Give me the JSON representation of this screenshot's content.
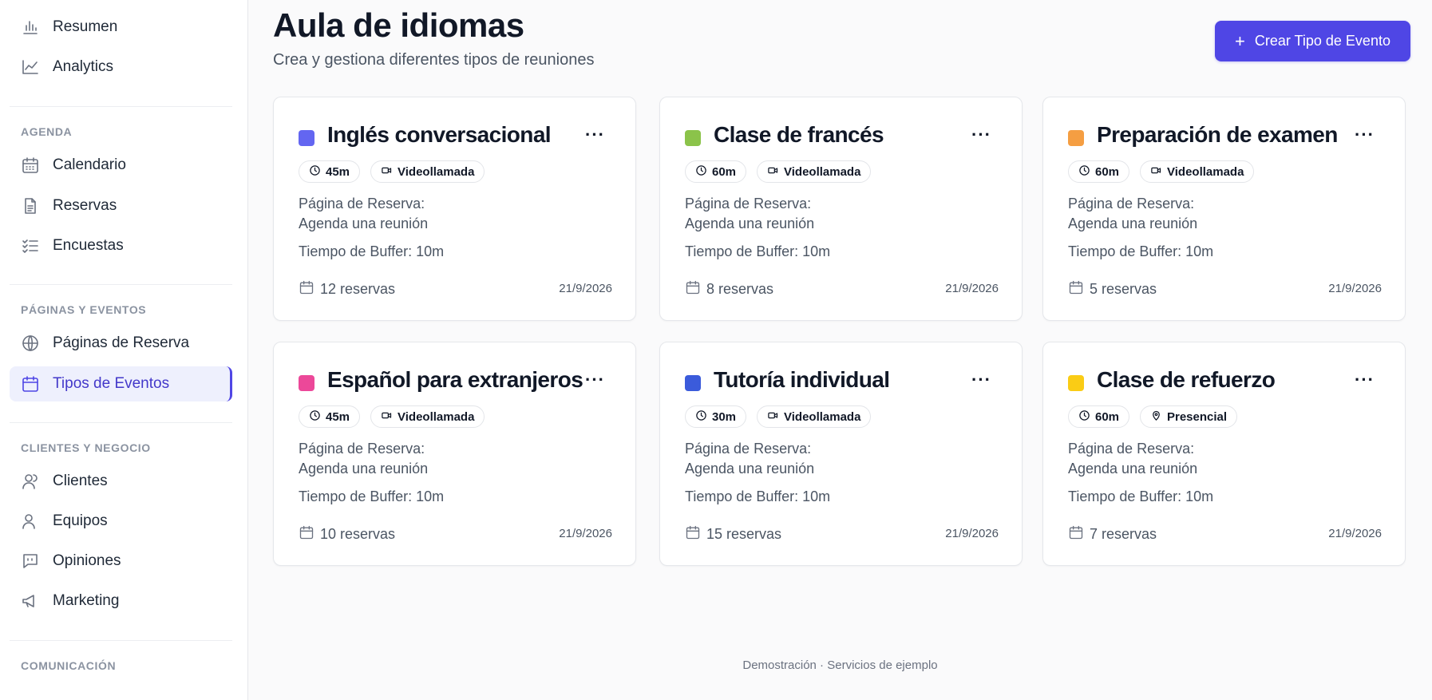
{
  "sidebar": {
    "top_items": [
      {
        "label": "Resumen",
        "icon": "bar-chart-icon"
      },
      {
        "label": "Analytics",
        "icon": "line-chart-icon"
      }
    ],
    "sections": [
      {
        "label": "AGENDA",
        "items": [
          {
            "label": "Calendario",
            "icon": "calendar-icon"
          },
          {
            "label": "Reservas",
            "icon": "document-icon"
          },
          {
            "label": "Encuestas",
            "icon": "checklist-icon"
          }
        ]
      },
      {
        "label": "PÁGINAS Y EVENTOS",
        "items": [
          {
            "label": "Páginas de Reserva",
            "icon": "globe-icon"
          },
          {
            "label": "Tipos de Eventos",
            "icon": "calendar-icon",
            "active": true
          }
        ]
      },
      {
        "label": "CLIENTES Y NEGOCIO",
        "items": [
          {
            "label": "Clientes",
            "icon": "user-icon"
          },
          {
            "label": "Equipos",
            "icon": "users-icon"
          },
          {
            "label": "Opiniones",
            "icon": "message-icon"
          },
          {
            "label": "Marketing",
            "icon": "megaphone-icon"
          }
        ]
      },
      {
        "label": "COMUNICACIÓN",
        "items": []
      }
    ]
  },
  "header": {
    "title": "Aula de idiomas",
    "subtitle": "Crea y gestiona diferentes tipos de reuniones",
    "create_button": "Crear Tipo de Evento"
  },
  "labels": {
    "booking_page_label": "Página de Reserva:",
    "booking_page_value": "Agenda una reunión",
    "buffer": "Tiempo de Buffer: 10m"
  },
  "events": [
    {
      "title": "Inglés conversacional",
      "color": "#6366f1",
      "duration": "45m",
      "mode": "Videollamada",
      "mode_icon": "video-icon",
      "reservations": "12 reservas",
      "date": "21/9/2026"
    },
    {
      "title": "Clase de francés",
      "color": "#8bc34a",
      "duration": "60m",
      "mode": "Videollamada",
      "mode_icon": "video-icon",
      "reservations": "8 reservas",
      "date": "21/9/2026"
    },
    {
      "title": "Preparación de examen",
      "color": "#f59e42",
      "duration": "60m",
      "mode": "Videollamada",
      "mode_icon": "video-icon",
      "reservations": "5 reservas",
      "date": "21/9/2026"
    },
    {
      "title": "Español para extranjeros",
      "color": "#ec4899",
      "duration": "45m",
      "mode": "Videollamada",
      "mode_icon": "video-icon",
      "reservations": "10 reservas",
      "date": "21/9/2026"
    },
    {
      "title": "Tutoría individual",
      "color": "#3b5bdb",
      "duration": "30m",
      "mode": "Videollamada",
      "mode_icon": "video-icon",
      "reservations": "15 reservas",
      "date": "21/9/2026"
    },
    {
      "title": "Clase de refuerzo",
      "color": "#facc15",
      "duration": "60m",
      "mode": "Presencial",
      "mode_icon": "map-pin-icon",
      "reservations": "7 reservas",
      "date": "21/9/2026"
    }
  ],
  "footer": "Demostración · Servicios de ejemplo"
}
